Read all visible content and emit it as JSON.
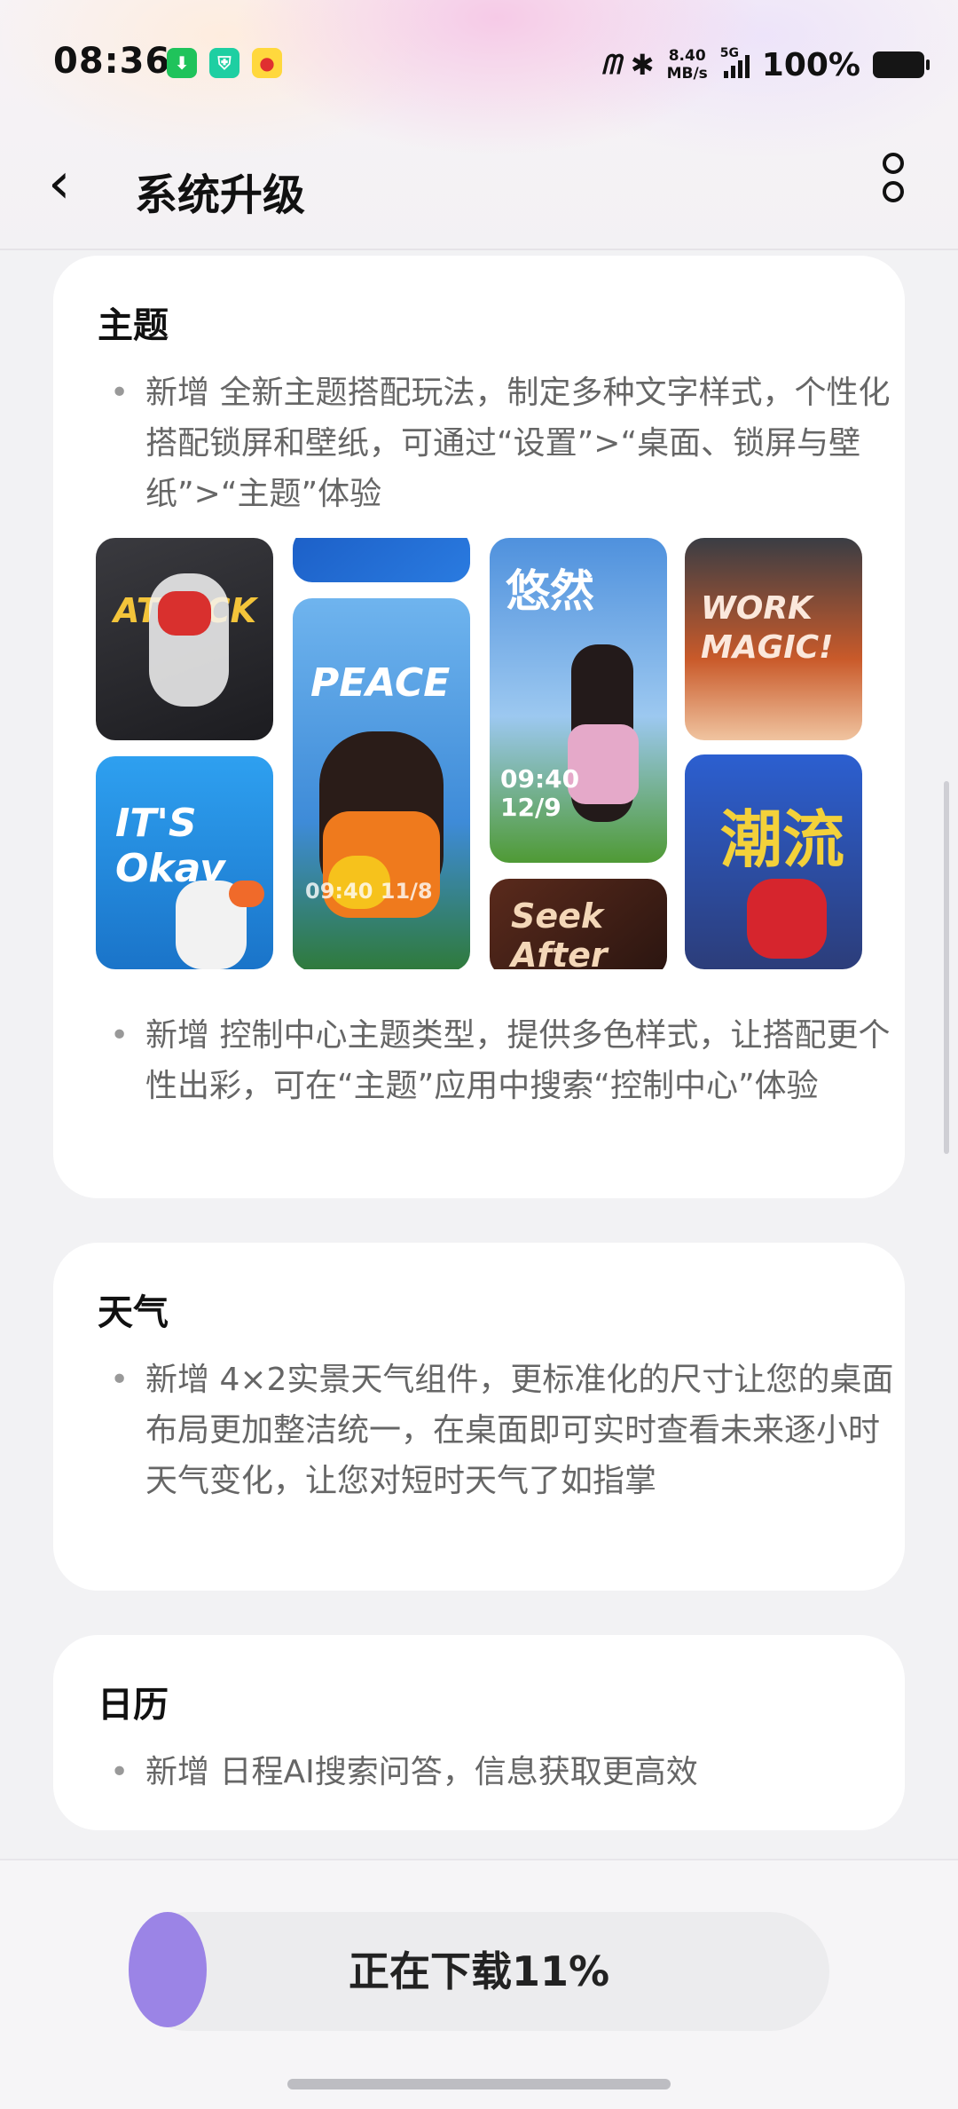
{
  "status_bar": {
    "time": "08:36",
    "notifications": [
      "download-app-icon",
      "security-app-icon",
      "weibo-app-icon"
    ],
    "nfc": "m",
    "speed_value": "8.40",
    "speed_unit": "MB/s",
    "network": "5G",
    "battery_percent": "100%"
  },
  "header": {
    "title": "系统升级"
  },
  "sections": [
    {
      "title": "主题",
      "bullets": [
        "新增 全新主题搭配玩法，制定多种文字样式，个性化搭配锁屏和壁纸，可通过“设置”>“桌面、锁屏与壁纸”>“主题”体验",
        "新增 控制中心主题类型，提供多色样式，让搭配更个性出彩，可在“主题”应用中搜索“控制中心”体验"
      ],
      "gallery": [
        {
          "art": "ATTACK",
          "clock": ""
        },
        {
          "art": "PEACE",
          "clock": "09:40  11/8"
        },
        {
          "art": "悠然",
          "clock": "09:40 12/9"
        },
        {
          "art": "WORK MAGIC!",
          "clock": ""
        },
        {
          "art": "IT'S Okay",
          "clock": ""
        },
        {
          "art": "Seek After",
          "clock": ""
        },
        {
          "art": "潮流",
          "clock": ""
        }
      ]
    },
    {
      "title": "天气",
      "bullets": [
        "新增 4×2实景天气组件，更标准化的尺寸让您的桌面布局更加整洁统一，在桌面即可实时查看未来逐小时天气变化，让您对短时天气了如指掌"
      ]
    },
    {
      "title": "日历",
      "bullets": [
        "新增 日程AI搜索问答，信息获取更高效"
      ]
    }
  ],
  "download": {
    "label": "正在下载11%",
    "progress_percent": 11
  },
  "colors": {
    "accent": "#9b84e6",
    "background": "#f2f2f4",
    "card": "#ffffff",
    "body_text": "#666666"
  }
}
